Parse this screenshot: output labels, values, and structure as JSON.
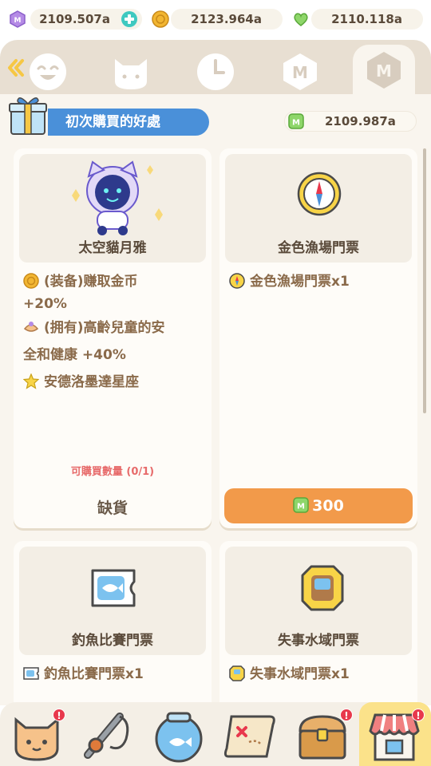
{
  "currencies": [
    {
      "name": "moon-gem",
      "value": "2109.507a",
      "color": "#b58be6"
    },
    {
      "name": "gold-coin",
      "value": "2123.964a",
      "color": "#f2b632"
    },
    {
      "name": "green-heart",
      "value": "2110.118a",
      "color": "#8ed66a"
    }
  ],
  "tabs": [
    {
      "name": "smile",
      "label": ""
    },
    {
      "name": "cat",
      "label": ""
    },
    {
      "name": "clock",
      "label": ""
    },
    {
      "name": "m-hex",
      "label": ""
    },
    {
      "name": "m-hex-active",
      "label": ""
    }
  ],
  "section": {
    "title": "初次購買的好處",
    "balance": "2109.987a"
  },
  "cards": [
    {
      "title": "太空貓月雅",
      "lines": [
        "(装备)赚取金币",
        "+20%",
        "(拥有)高齡兒童的安",
        "全和健康 +40%",
        "安德洛墨達星座"
      ],
      "limit": "可購買數量 (0/1)",
      "status": "缺貨"
    },
    {
      "title": "金色漁場門票",
      "lines": [
        "金色漁場門票x1"
      ],
      "price": "300"
    },
    {
      "title": "釣魚比賽門票",
      "lines": [
        "釣魚比賽門票x1"
      ]
    },
    {
      "title": "失事水域門票",
      "lines": [
        "失事水域門票x1"
      ]
    }
  ],
  "bottom_nav": [
    {
      "name": "cat-face",
      "badge": "!"
    },
    {
      "name": "fishing-rod",
      "badge": ""
    },
    {
      "name": "fishbowl",
      "badge": ""
    },
    {
      "name": "treasure-map",
      "badge": ""
    },
    {
      "name": "treasure-chest",
      "badge": "!"
    },
    {
      "name": "shop",
      "badge": "!"
    }
  ],
  "colors": {
    "accent_blue": "#4a90d9",
    "buy_orange": "#f29a4a",
    "limit_red": "#e76a6a",
    "nav_active": "#fbe28a"
  }
}
